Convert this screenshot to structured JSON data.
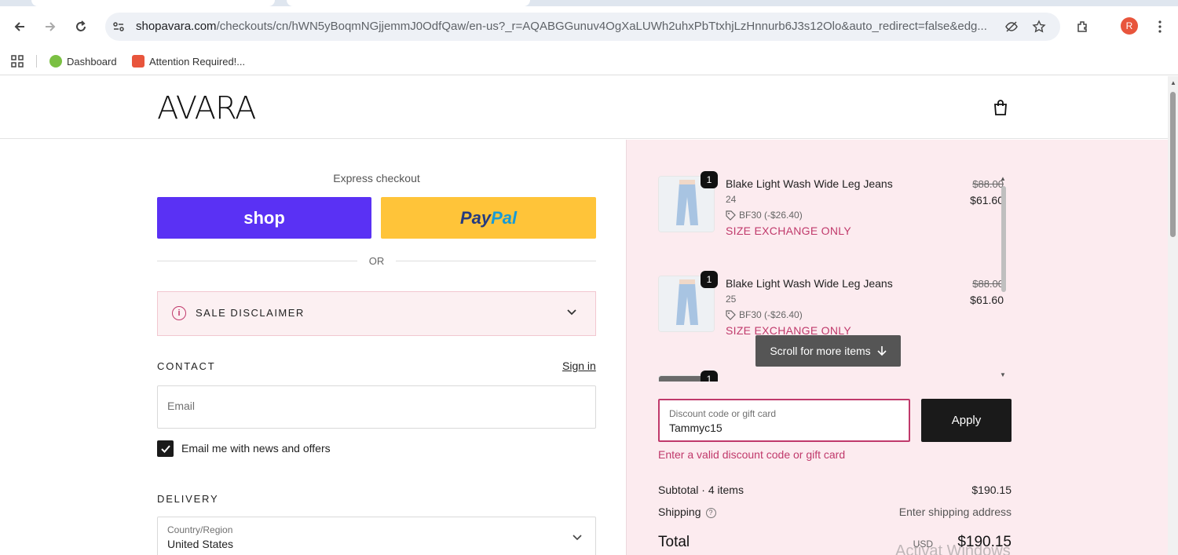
{
  "browser": {
    "url_host": "shopavara.com",
    "url_rest": "/checkouts/cn/hWN5yBoqmNGjjemmJ0OdfQaw/en-us?_r=AQABGGunuv4OgXaLUWh2uhxPbTtxhjLzHnnurb6J3s12Olo&auto_redirect=false&edg...",
    "profile_initial": "R",
    "bookmarks": [
      {
        "label": "Dashboard"
      },
      {
        "label": "Attention Required!..."
      }
    ]
  },
  "header": {
    "logo": "AVARA"
  },
  "express": {
    "label": "Express checkout",
    "shop_label": "shop",
    "paypal_part1": "Pay",
    "paypal_part2": "Pal",
    "or_label": "OR"
  },
  "disclaimer": {
    "label": "SALE DISCLAIMER"
  },
  "contact": {
    "heading": "CONTACT",
    "signin": "Sign in",
    "email_placeholder": "Email",
    "newsletter_label": "Email me with news and offers"
  },
  "delivery": {
    "heading": "DELIVERY",
    "country_label": "Country/Region",
    "country_value": "United States"
  },
  "summary": {
    "items": [
      {
        "qty": "1",
        "name": "Blake Light Wash Wide Leg Jeans",
        "size": "24",
        "discount": "BF30 (-$26.40)",
        "note": "SIZE EXCHANGE ONLY",
        "price_old": "$88.00",
        "price_new": "$61.60"
      },
      {
        "qty": "1",
        "name": "Blake Light Wash Wide Leg Jeans",
        "size": "25",
        "discount": "BF30 (-$26.40)",
        "note": "SIZE EXCHANGE ONLY",
        "price_old": "$88.00",
        "price_new": "$61.60"
      },
      {
        "qty": "1"
      }
    ],
    "scroll_tip": "Scroll for more items",
    "discount_label": "Discount code or gift card",
    "discount_value": "Tammyc15",
    "apply_label": "Apply",
    "error": "Enter a valid discount code or gift card",
    "subtotal_label": "Subtotal · 4 items",
    "subtotal_value": "$190.15",
    "shipping_label": "Shipping",
    "shipping_value": "Enter shipping address",
    "total_label": "Total",
    "total_currency": "USD",
    "total_value": "$190.15",
    "watermark": "Activat Windows"
  },
  "colors": {
    "shop": "#5a31f4",
    "paypal": "#ffc439",
    "accent": "#c0396b",
    "summary_bg": "#fcebef"
  }
}
